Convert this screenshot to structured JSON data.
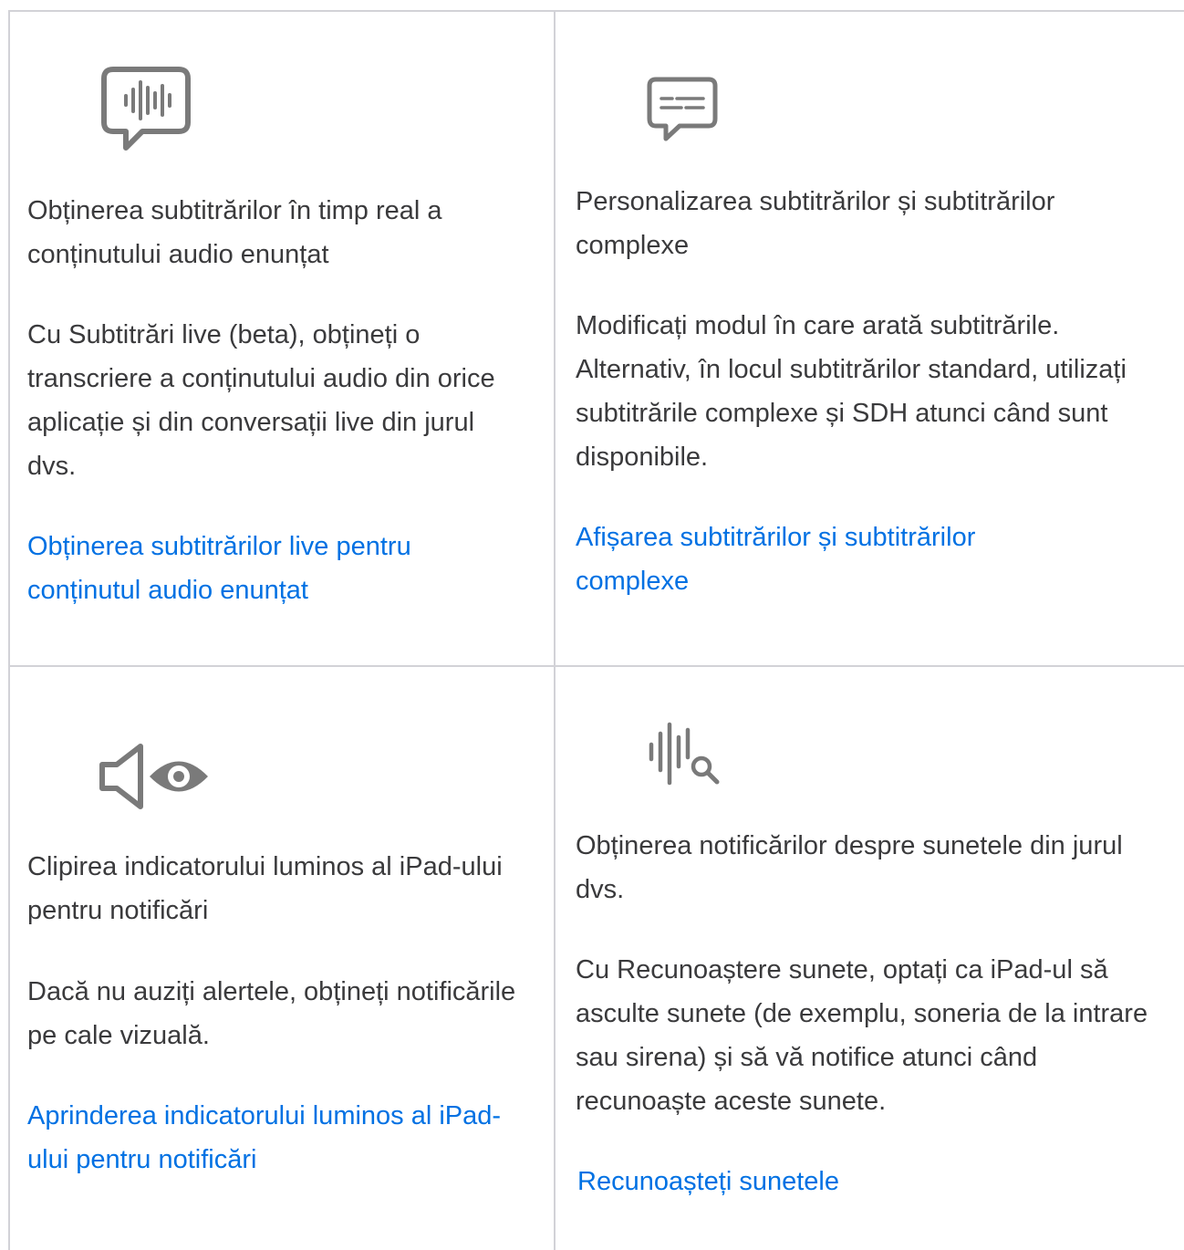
{
  "cards": [
    {
      "icon": "live-captions-speech-bubble-icon",
      "title": "Obținerea subtitrărilor în timp real a conținutului audio enunțat",
      "description": "Cu Subtitrări live (beta), obțineți o transcriere a conținutului audio din orice aplicație și din conversații live din jurul dvs.",
      "link": "Obținerea subtitrărilor live pentru conținutul audio enunțat"
    },
    {
      "icon": "subtitles-speech-bubble-icon",
      "title": "Personalizarea subtitrărilor și subtitrărilor complexe",
      "description": "Modificați modul în care arată subtitrările. Alternativ, în locul subtitrărilor standard, utilizați subtitrările complexe și SDH atunci când sunt disponibile.",
      "link": "Afișarea subtitrărilor și subtitrărilor complexe"
    },
    {
      "icon": "speaker-eye-icon",
      "title": "Clipirea indicatorului luminos al iPad-ului pentru notificări",
      "description": "Dacă nu auziți alertele, obțineți notificările pe cale vizuală.",
      "link": "Aprinderea indicatorului luminos al iPad-ului pentru notificări"
    },
    {
      "icon": "waveform-magnifier-icon",
      "title": "Obținerea notificărilor despre sunetele din jurul dvs.",
      "description": "Cu Recunoaștere sunete, optați ca iPad-ul să asculte sunete (de exemplu, soneria de la intrare sau sirena) și să vă notifice atunci când recunoaște aceste sunete.",
      "link": "Recunoașteți sunetele"
    }
  ]
}
